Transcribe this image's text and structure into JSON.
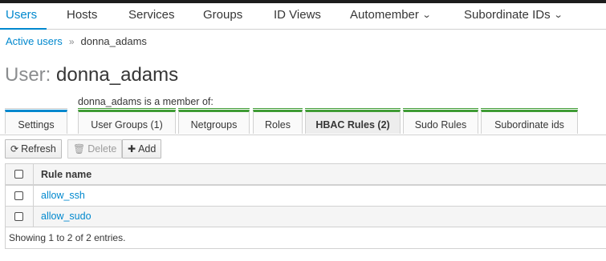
{
  "nav": {
    "items": [
      {
        "label": "Users",
        "active": true
      },
      {
        "label": "Hosts"
      },
      {
        "label": "Services"
      },
      {
        "label": "Groups"
      },
      {
        "label": "ID Views"
      },
      {
        "label": "Automember",
        "dropdown": true
      },
      {
        "label": "Subordinate IDs",
        "dropdown": true
      }
    ],
    "dropdown_icon": "chevron-down-icon"
  },
  "breadcrumb": {
    "parent": "Active users",
    "separator": "»",
    "current": "donna_adams"
  },
  "page": {
    "title_prefix": "User:",
    "title_name": "donna_adams",
    "member_of": "donna_adams is a member of:"
  },
  "tabs": {
    "settings": "Settings",
    "user_groups": "User Groups (1)",
    "netgroups": "Netgroups",
    "roles": "Roles",
    "hbac_rules": "HBAC Rules (2)",
    "sudo_rules": "Sudo Rules",
    "subordinate_ids": "Subordinate ids",
    "selected": "hbac_rules"
  },
  "toolbar": {
    "refresh": "Refresh",
    "delete": "Delete",
    "add": "Add"
  },
  "table": {
    "column_header": "Rule name",
    "rows": [
      "allow_ssh",
      "allow_sudo"
    ],
    "footer": "Showing 1 to 2 of 2 entries."
  },
  "colors": {
    "link": "#0088ce",
    "membership_tab_accent": "#3f9c35",
    "settings_tab_accent": "#0088ce"
  }
}
